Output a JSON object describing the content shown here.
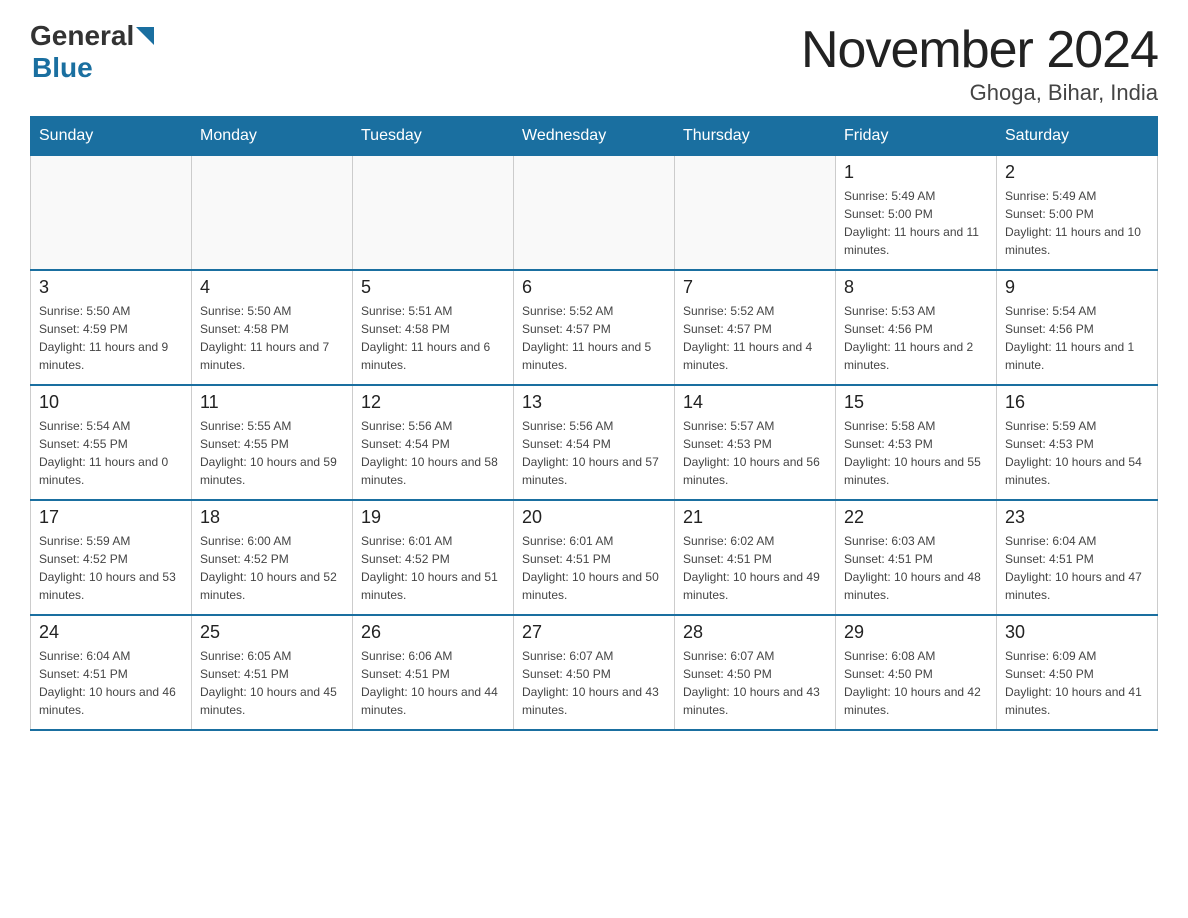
{
  "header": {
    "title": "November 2024",
    "subtitle": "Ghoga, Bihar, India",
    "logo_general": "General",
    "logo_blue": "Blue"
  },
  "days_of_week": [
    "Sunday",
    "Monday",
    "Tuesday",
    "Wednesday",
    "Thursday",
    "Friday",
    "Saturday"
  ],
  "weeks": [
    [
      {
        "day": "",
        "info": ""
      },
      {
        "day": "",
        "info": ""
      },
      {
        "day": "",
        "info": ""
      },
      {
        "day": "",
        "info": ""
      },
      {
        "day": "",
        "info": ""
      },
      {
        "day": "1",
        "info": "Sunrise: 5:49 AM\nSunset: 5:00 PM\nDaylight: 11 hours and 11 minutes."
      },
      {
        "day": "2",
        "info": "Sunrise: 5:49 AM\nSunset: 5:00 PM\nDaylight: 11 hours and 10 minutes."
      }
    ],
    [
      {
        "day": "3",
        "info": "Sunrise: 5:50 AM\nSunset: 4:59 PM\nDaylight: 11 hours and 9 minutes."
      },
      {
        "day": "4",
        "info": "Sunrise: 5:50 AM\nSunset: 4:58 PM\nDaylight: 11 hours and 7 minutes."
      },
      {
        "day": "5",
        "info": "Sunrise: 5:51 AM\nSunset: 4:58 PM\nDaylight: 11 hours and 6 minutes."
      },
      {
        "day": "6",
        "info": "Sunrise: 5:52 AM\nSunset: 4:57 PM\nDaylight: 11 hours and 5 minutes."
      },
      {
        "day": "7",
        "info": "Sunrise: 5:52 AM\nSunset: 4:57 PM\nDaylight: 11 hours and 4 minutes."
      },
      {
        "day": "8",
        "info": "Sunrise: 5:53 AM\nSunset: 4:56 PM\nDaylight: 11 hours and 2 minutes."
      },
      {
        "day": "9",
        "info": "Sunrise: 5:54 AM\nSunset: 4:56 PM\nDaylight: 11 hours and 1 minute."
      }
    ],
    [
      {
        "day": "10",
        "info": "Sunrise: 5:54 AM\nSunset: 4:55 PM\nDaylight: 11 hours and 0 minutes."
      },
      {
        "day": "11",
        "info": "Sunrise: 5:55 AM\nSunset: 4:55 PM\nDaylight: 10 hours and 59 minutes."
      },
      {
        "day": "12",
        "info": "Sunrise: 5:56 AM\nSunset: 4:54 PM\nDaylight: 10 hours and 58 minutes."
      },
      {
        "day": "13",
        "info": "Sunrise: 5:56 AM\nSunset: 4:54 PM\nDaylight: 10 hours and 57 minutes."
      },
      {
        "day": "14",
        "info": "Sunrise: 5:57 AM\nSunset: 4:53 PM\nDaylight: 10 hours and 56 minutes."
      },
      {
        "day": "15",
        "info": "Sunrise: 5:58 AM\nSunset: 4:53 PM\nDaylight: 10 hours and 55 minutes."
      },
      {
        "day": "16",
        "info": "Sunrise: 5:59 AM\nSunset: 4:53 PM\nDaylight: 10 hours and 54 minutes."
      }
    ],
    [
      {
        "day": "17",
        "info": "Sunrise: 5:59 AM\nSunset: 4:52 PM\nDaylight: 10 hours and 53 minutes."
      },
      {
        "day": "18",
        "info": "Sunrise: 6:00 AM\nSunset: 4:52 PM\nDaylight: 10 hours and 52 minutes."
      },
      {
        "day": "19",
        "info": "Sunrise: 6:01 AM\nSunset: 4:52 PM\nDaylight: 10 hours and 51 minutes."
      },
      {
        "day": "20",
        "info": "Sunrise: 6:01 AM\nSunset: 4:51 PM\nDaylight: 10 hours and 50 minutes."
      },
      {
        "day": "21",
        "info": "Sunrise: 6:02 AM\nSunset: 4:51 PM\nDaylight: 10 hours and 49 minutes."
      },
      {
        "day": "22",
        "info": "Sunrise: 6:03 AM\nSunset: 4:51 PM\nDaylight: 10 hours and 48 minutes."
      },
      {
        "day": "23",
        "info": "Sunrise: 6:04 AM\nSunset: 4:51 PM\nDaylight: 10 hours and 47 minutes."
      }
    ],
    [
      {
        "day": "24",
        "info": "Sunrise: 6:04 AM\nSunset: 4:51 PM\nDaylight: 10 hours and 46 minutes."
      },
      {
        "day": "25",
        "info": "Sunrise: 6:05 AM\nSunset: 4:51 PM\nDaylight: 10 hours and 45 minutes."
      },
      {
        "day": "26",
        "info": "Sunrise: 6:06 AM\nSunset: 4:51 PM\nDaylight: 10 hours and 44 minutes."
      },
      {
        "day": "27",
        "info": "Sunrise: 6:07 AM\nSunset: 4:50 PM\nDaylight: 10 hours and 43 minutes."
      },
      {
        "day": "28",
        "info": "Sunrise: 6:07 AM\nSunset: 4:50 PM\nDaylight: 10 hours and 43 minutes."
      },
      {
        "day": "29",
        "info": "Sunrise: 6:08 AM\nSunset: 4:50 PM\nDaylight: 10 hours and 42 minutes."
      },
      {
        "day": "30",
        "info": "Sunrise: 6:09 AM\nSunset: 4:50 PM\nDaylight: 10 hours and 41 minutes."
      }
    ]
  ]
}
